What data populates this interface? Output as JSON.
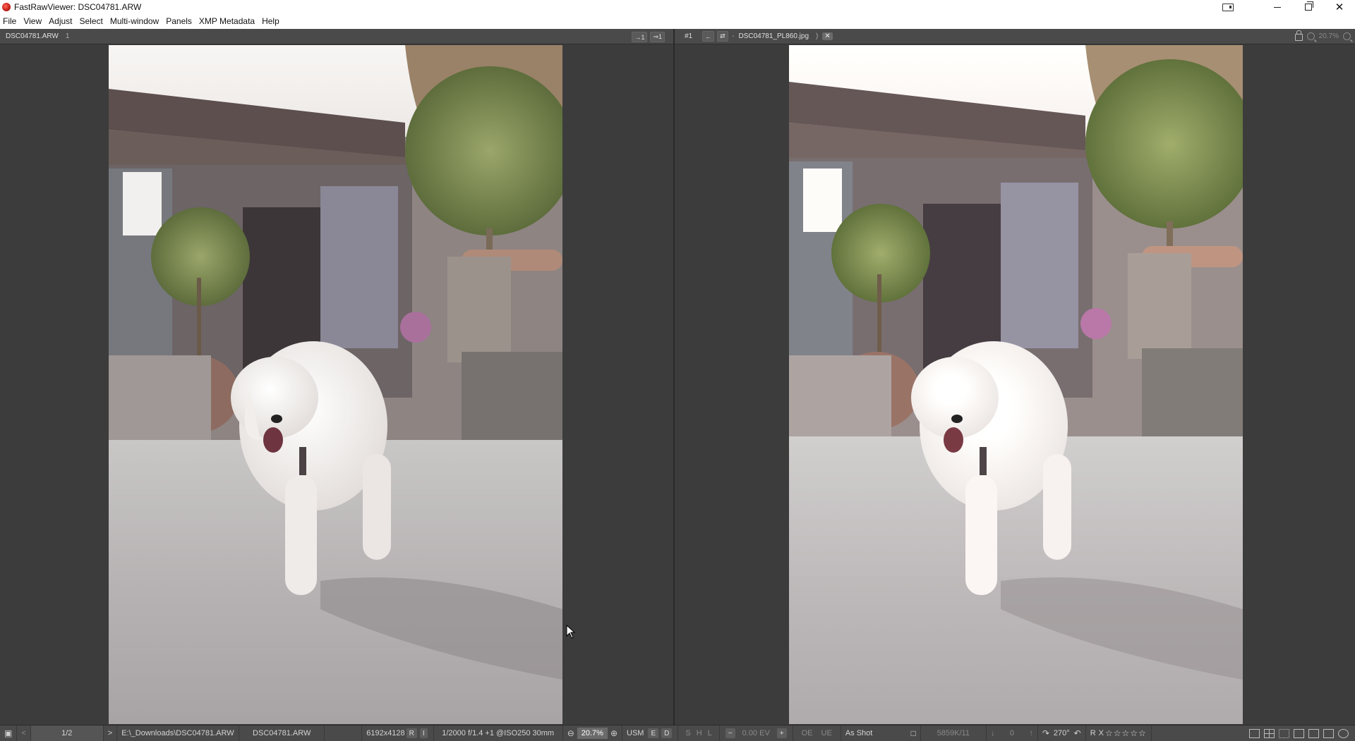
{
  "window": {
    "title": "FastRawViewer: DSC04781.ARW",
    "close_glyph": "✕"
  },
  "menu": [
    "File",
    "View",
    "Adjust",
    "Select",
    "Multi-window",
    "Panels",
    "XMP Metadata",
    "Help"
  ],
  "left_panel": {
    "filename": "DSC04781.ARW",
    "index": "1",
    "btn1": "→1",
    "btn2": "⇒1"
  },
  "right_panel": {
    "slot": "#1",
    "btn_back": "←",
    "btn_swap": "⇄",
    "btn_dot": "•",
    "filename": "DSC04781_PL860.jpg",
    "chevron": ")",
    "close": "✕",
    "zoom": "20.7%"
  },
  "status": {
    "counter": "1/2",
    "path": "E:\\_Downloads\\DSC04781.ARW",
    "filename": "DSC04781.ARW",
    "dimensions": "6192x4128",
    "r_flag": "R",
    "i_flag": "I",
    "exposure": "1/2000 f/1.4 +1 @ISO250 30mm",
    "zoom": "20.7%",
    "usm": "USM",
    "e": "E",
    "d": "D",
    "s": "S",
    "h": "H",
    "l": "L",
    "ev": "0.00 EV",
    "oe": "OE",
    "ue": "UE",
    "wb": "As Shot",
    "temp": "5859K/11",
    "tint": "0",
    "rotation": "270°",
    "rating_r": "R",
    "rating_x": "X",
    "stars": "☆☆☆☆☆"
  },
  "colors": {
    "chrome": "#4a4a4a",
    "background": "#3c3c3c",
    "titlebar": "#ffffff"
  }
}
